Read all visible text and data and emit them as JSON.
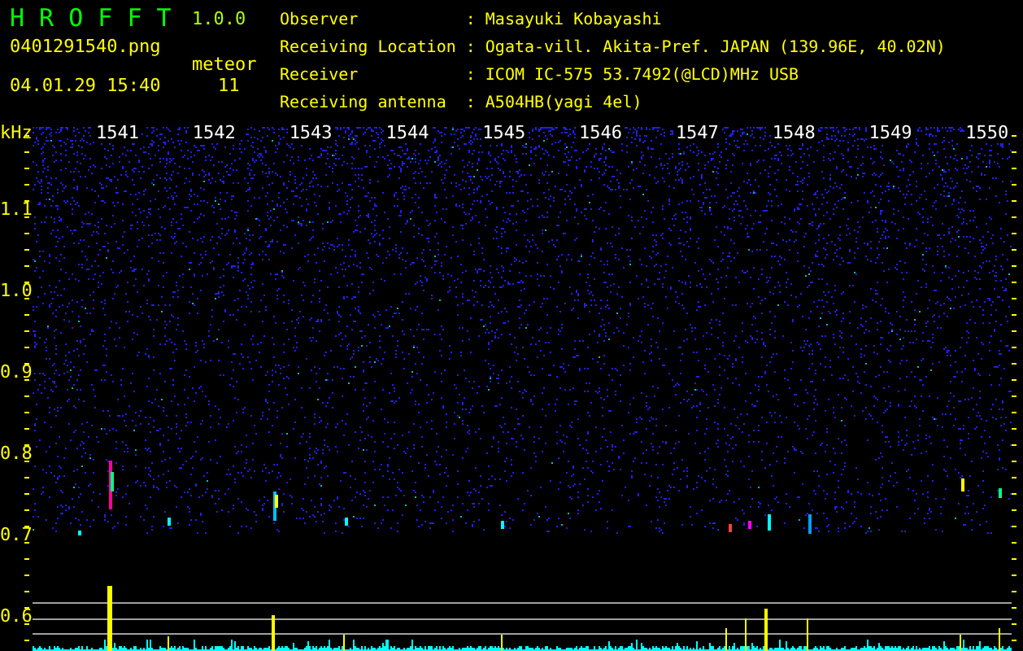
{
  "app": {
    "title": "H R O F F T",
    "version": "1.0.0"
  },
  "image_file": "0401291540.png",
  "timestamp": "04.01.29 15:40",
  "meteor": {
    "label": "meteor",
    "count": "11"
  },
  "info": [
    {
      "label": "Observer",
      "separator": ":",
      "value": "Masayuki Kobayashi"
    },
    {
      "label": "Receiving Location",
      "separator": ":",
      "value": "Ogata-vill. Akita-Pref. JAPAN (139.96E, 40.02N)"
    },
    {
      "label": "Receiver",
      "separator": ":",
      "value": "ICOM IC-575 53.7492(@LCD)MHz USB"
    },
    {
      "label": "Receiving antenna",
      "separator": ":",
      "value": "A504HB(yagi 4el)"
    }
  ],
  "plot": {
    "unit": "kHz",
    "x_labels": [
      "1541",
      "1542",
      "1543",
      "1544",
      "1545",
      "1546",
      "1547",
      "1548",
      "1549",
      "1550"
    ],
    "y_labels": [
      "1.1",
      "1.0",
      "0.9",
      "0.8",
      "0.7",
      "0.6"
    ]
  }
}
